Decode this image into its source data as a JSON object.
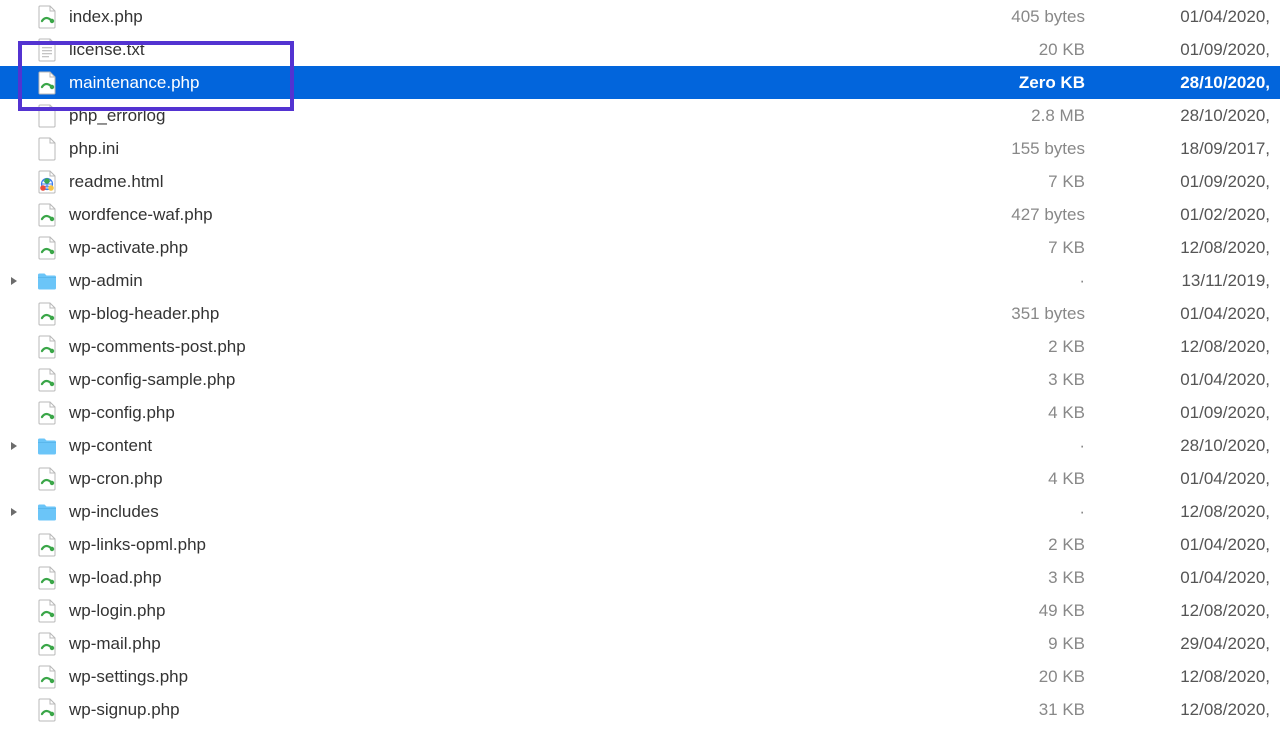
{
  "files": [
    {
      "name": "index.php",
      "size": "405 bytes",
      "date": "01/04/2020,",
      "icon": "php",
      "folder": false,
      "selected": false
    },
    {
      "name": "license.txt",
      "size": "20 KB",
      "date": "01/09/2020,",
      "icon": "txt",
      "folder": false,
      "selected": false
    },
    {
      "name": "maintenance.php",
      "size": "Zero KB",
      "date": "28/10/2020,",
      "icon": "php",
      "folder": false,
      "selected": true
    },
    {
      "name": "php_errorlog",
      "size": "2.8 MB",
      "date": "28/10/2020,",
      "icon": "blank",
      "folder": false,
      "selected": false
    },
    {
      "name": "php.ini",
      "size": "155 bytes",
      "date": "18/09/2017,",
      "icon": "blank",
      "folder": false,
      "selected": false
    },
    {
      "name": "readme.html",
      "size": "7 KB",
      "date": "01/09/2020,",
      "icon": "html",
      "folder": false,
      "selected": false
    },
    {
      "name": "wordfence-waf.php",
      "size": "427 bytes",
      "date": "01/02/2020,",
      "icon": "php",
      "folder": false,
      "selected": false
    },
    {
      "name": "wp-activate.php",
      "size": "7 KB",
      "date": "12/08/2020,",
      "icon": "php",
      "folder": false,
      "selected": false
    },
    {
      "name": "wp-admin",
      "size": "·",
      "date": "13/11/2019,",
      "icon": "folder",
      "folder": true,
      "selected": false
    },
    {
      "name": "wp-blog-header.php",
      "size": "351 bytes",
      "date": "01/04/2020,",
      "icon": "php",
      "folder": false,
      "selected": false
    },
    {
      "name": "wp-comments-post.php",
      "size": "2 KB",
      "date": "12/08/2020,",
      "icon": "php",
      "folder": false,
      "selected": false
    },
    {
      "name": "wp-config-sample.php",
      "size": "3 KB",
      "date": "01/04/2020,",
      "icon": "php",
      "folder": false,
      "selected": false
    },
    {
      "name": "wp-config.php",
      "size": "4 KB",
      "date": "01/09/2020,",
      "icon": "php",
      "folder": false,
      "selected": false
    },
    {
      "name": "wp-content",
      "size": "·",
      "date": "28/10/2020,",
      "icon": "folder",
      "folder": true,
      "selected": false
    },
    {
      "name": "wp-cron.php",
      "size": "4 KB",
      "date": "01/04/2020,",
      "icon": "php",
      "folder": false,
      "selected": false
    },
    {
      "name": "wp-includes",
      "size": "·",
      "date": "12/08/2020,",
      "icon": "folder",
      "folder": true,
      "selected": false
    },
    {
      "name": "wp-links-opml.php",
      "size": "2 KB",
      "date": "01/04/2020,",
      "icon": "php",
      "folder": false,
      "selected": false
    },
    {
      "name": "wp-load.php",
      "size": "3 KB",
      "date": "01/04/2020,",
      "icon": "php",
      "folder": false,
      "selected": false
    },
    {
      "name": "wp-login.php",
      "size": "49 KB",
      "date": "12/08/2020,",
      "icon": "php",
      "folder": false,
      "selected": false
    },
    {
      "name": "wp-mail.php",
      "size": "9 KB",
      "date": "29/04/2020,",
      "icon": "php",
      "folder": false,
      "selected": false
    },
    {
      "name": "wp-settings.php",
      "size": "20 KB",
      "date": "12/08/2020,",
      "icon": "php",
      "folder": false,
      "selected": false
    },
    {
      "name": "wp-signup.php",
      "size": "31 KB",
      "date": "12/08/2020,",
      "icon": "php",
      "folder": false,
      "selected": false
    }
  ]
}
